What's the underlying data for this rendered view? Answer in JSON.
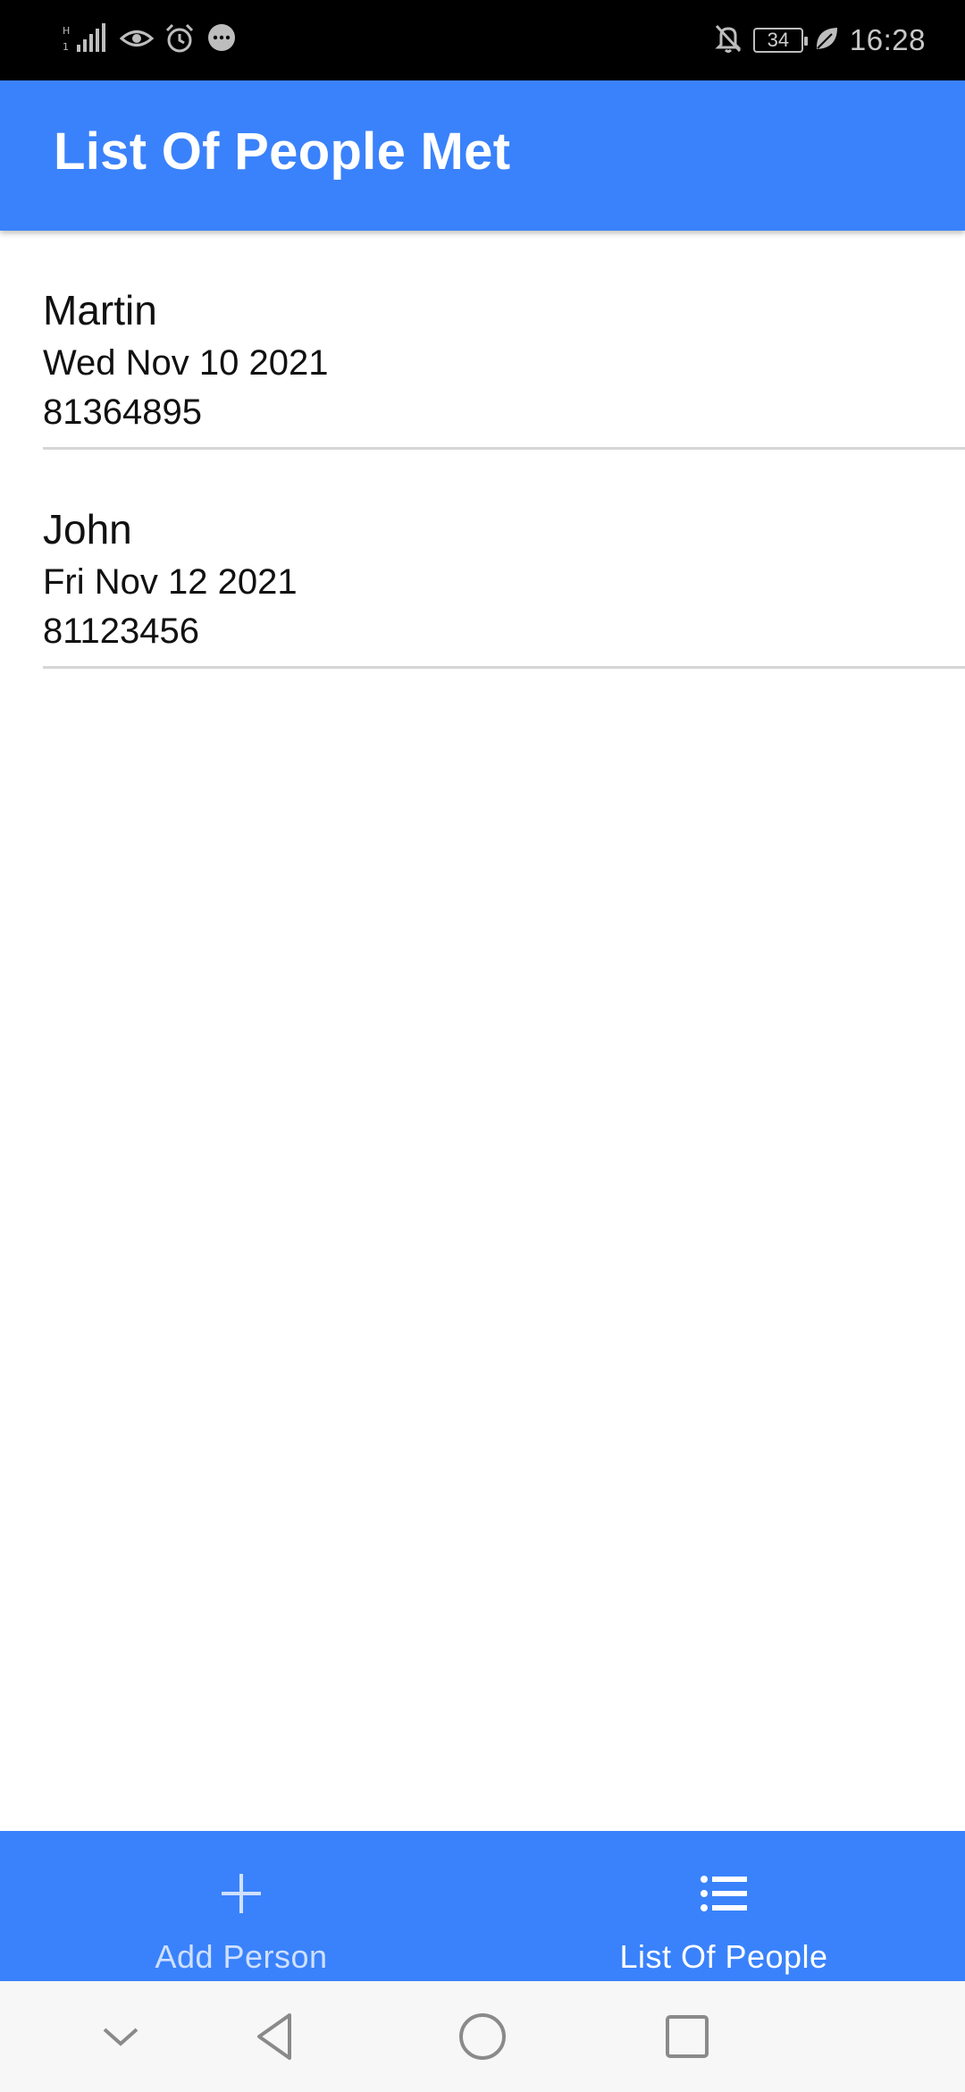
{
  "status_bar": {
    "time": "16:28",
    "battery": "34",
    "left_icons": [
      "signal-icon",
      "eye-icon",
      "alarm-icon",
      "message-icon"
    ],
    "right_icons": [
      "mute-notifications-icon",
      "battery-icon",
      "leaf-icon"
    ]
  },
  "app_bar": {
    "title": "List Of People Met",
    "color": "#3a82fb"
  },
  "people": [
    {
      "name": "Martin",
      "date": "Wed Nov 10 2021",
      "phone": "81364895"
    },
    {
      "name": "John",
      "date": "Fri Nov 12 2021",
      "phone": "81123456"
    }
  ],
  "bottom_nav": {
    "items": [
      {
        "label": "Add Person",
        "icon": "plus-icon",
        "active": false
      },
      {
        "label": "List Of People",
        "icon": "list-icon",
        "active": true
      }
    ]
  },
  "system_nav": {
    "buttons": [
      "collapse-icon",
      "back-icon",
      "home-icon",
      "recents-icon"
    ]
  }
}
